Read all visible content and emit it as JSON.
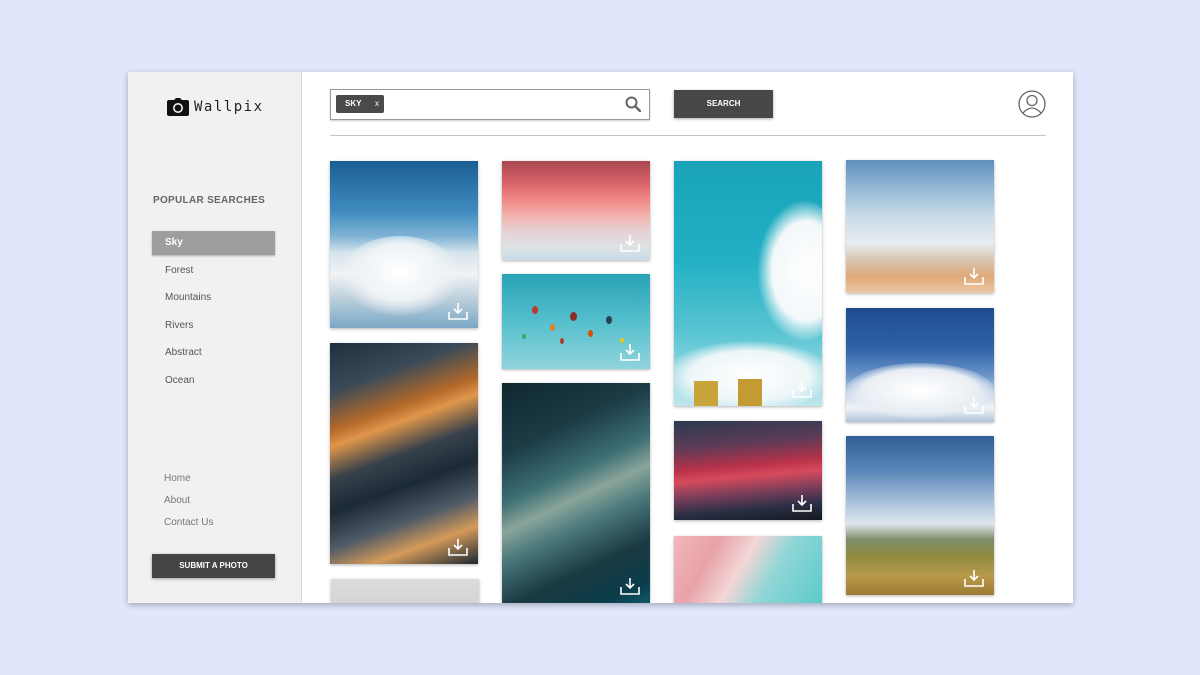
{
  "app": {
    "name": "Wallpix"
  },
  "sidebar": {
    "popular_title": "POPULAR SEARCHES",
    "categories": [
      {
        "label": "Sky",
        "active": true
      },
      {
        "label": "Forest"
      },
      {
        "label": "Mountains"
      },
      {
        "label": "Rivers"
      },
      {
        "label": "Abstract"
      },
      {
        "label": "Ocean"
      }
    ],
    "links": [
      "Home",
      "About",
      "Contact Us"
    ],
    "submit_label": "SUBMIT A PHOTO"
  },
  "search": {
    "tag": "SKY",
    "tag_remove": "x",
    "value": "",
    "button_label": "SEARCH"
  },
  "gallery": {
    "tiles": [
      {
        "subject": "cumulus clouds over blue sky"
      },
      {
        "subject": "pink sunset clouds"
      },
      {
        "subject": "hot air balloons in teal sky"
      },
      {
        "subject": "tall blue sky with clouds and buildings"
      },
      {
        "subject": "wispy clouds over beach"
      },
      {
        "subject": "dramatic clouds with sun rays"
      },
      {
        "subject": "milky way night sky"
      },
      {
        "subject": "red clouds over forest at dusk"
      },
      {
        "subject": "deep blue sky with clouds"
      },
      {
        "subject": "clouds over pink and teal sky"
      },
      {
        "subject": "clouds over grassy hills"
      },
      {
        "subject": "pale sky"
      }
    ]
  },
  "colors": {
    "background": "#e0e7fc",
    "sidebar": "#f1f1f1",
    "active_category": "#9e9e9e",
    "dark_button": "#444444"
  }
}
